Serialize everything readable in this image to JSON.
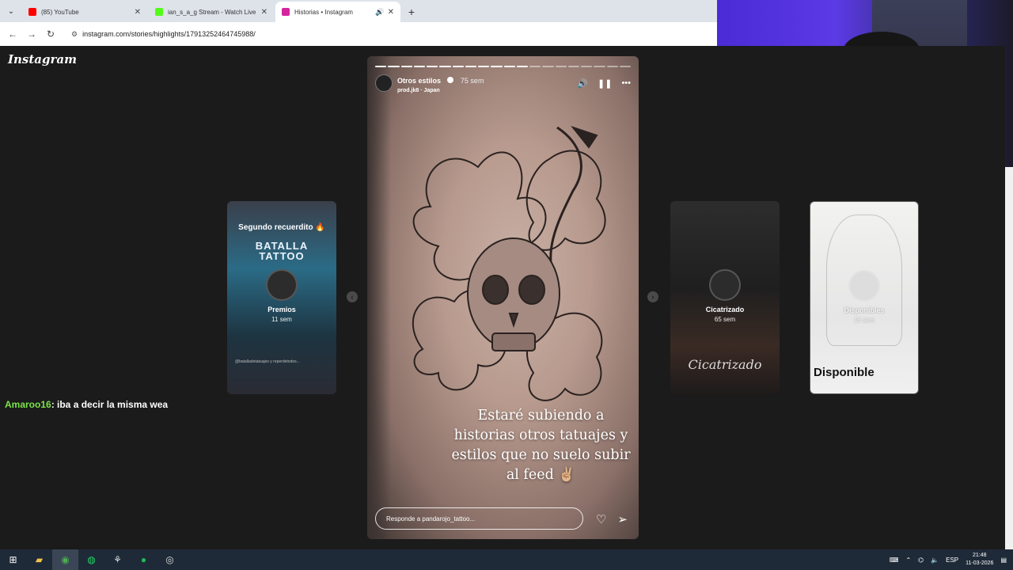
{
  "browser": {
    "tabs": [
      {
        "title": "(85) YouTube",
        "color": "#ff0000"
      },
      {
        "title": "ian_s_a_g Stream - Watch Live",
        "color": "#53fc18"
      },
      {
        "title": "Historias • Instagram",
        "color": "#d6249f"
      }
    ],
    "url": "instagram.com/stories/highlights/17913252464745988/"
  },
  "instagram": {
    "logo": "Instagram",
    "story": {
      "username": "Otros estilos",
      "time": "75 sem",
      "music": "prod.jk8 · Japan",
      "text": "Estaré subiendo a historias otros tatuajes y estilos que no suelo subir al feed ✌🏼",
      "reply_placeholder": "Responde a pandarojo_tattoo...",
      "segments_total": 20,
      "segments_done": 12
    },
    "cards": [
      {
        "title": "Premios",
        "age": "11 sem",
        "top_text": "Segundo recuerdito 🔥",
        "brand": "BATALLA TATTOO",
        "caption": "@batalladetatuajes y reperdetodos..."
      },
      {
        "title": "Cicatrizado",
        "age": "65 sem",
        "script": "Cicatrizado"
      },
      {
        "title": "Disponibles",
        "age": "15 sem",
        "word": "Disponible"
      }
    ]
  },
  "chat": {
    "user": "Amaroo16",
    "message": ": iba a decir la misma wea"
  },
  "taskbar": {
    "lang": "ESP",
    "time": "21:48",
    "date": "11-03-2026"
  }
}
